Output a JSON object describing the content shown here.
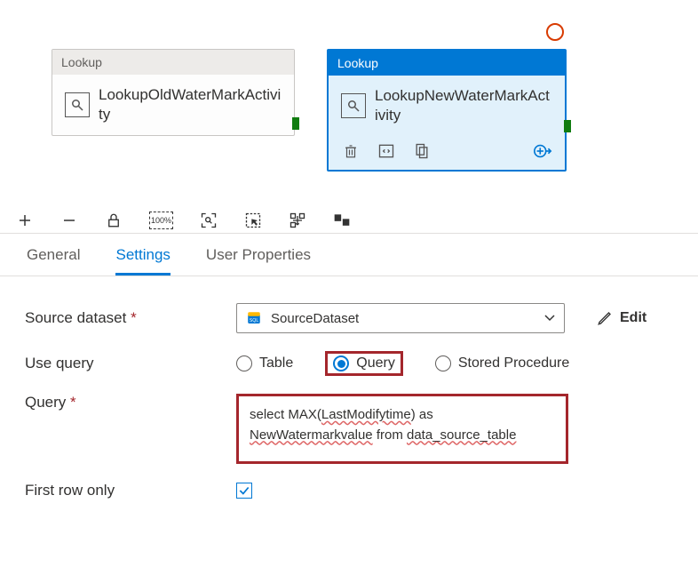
{
  "canvas": {
    "activity_type": "Lookup",
    "box1_name": "LookupOldWaterMarkActivity",
    "box2_name": "LookupNewWaterMarkActivity"
  },
  "tabs": {
    "general": "General",
    "settings": "Settings",
    "user_properties": "User Properties"
  },
  "form": {
    "source_dataset_label": "Source dataset",
    "source_dataset_value": "SourceDataset",
    "edit_label": "Edit",
    "use_query_label": "Use query",
    "radio_table": "Table",
    "radio_query": "Query",
    "radio_sp": "Stored Procedure",
    "query_label": "Query",
    "query_text_1a": "select MAX(",
    "query_text_1b": "LastModifytime",
    "query_text_1c": ") as",
    "query_text_2a": "NewWatermarkvalue",
    "query_text_2b": " from ",
    "query_text_2c": "data_source_table",
    "first_row_label": "First row only",
    "first_row_checked": true
  }
}
